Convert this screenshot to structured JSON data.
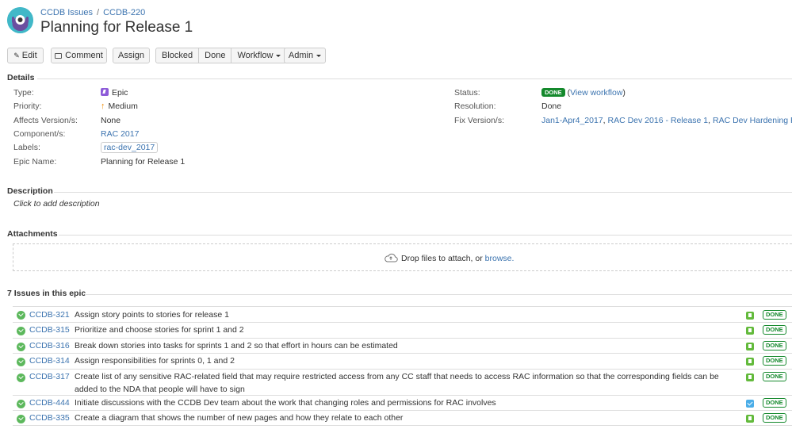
{
  "header": {
    "breadcrumb": {
      "project": "CCDB Issues",
      "separator": "/",
      "issue_key": "CCDB-220"
    },
    "title": "Planning for Release 1"
  },
  "toolbar": {
    "edit": "Edit",
    "comment": "Comment",
    "assign": "Assign",
    "blocked": "Blocked",
    "done": "Done",
    "workflow": "Workflow",
    "admin": "Admin"
  },
  "details": {
    "heading": "Details",
    "left": [
      {
        "label": "Type:",
        "value": "Epic",
        "icon": "epic-icon"
      },
      {
        "label": "Priority:",
        "value": "Medium",
        "icon": "priority-up-arrow-icon"
      },
      {
        "label": "Affects Version/s:",
        "value": "None"
      },
      {
        "label": "Component/s:",
        "value": "RAC 2017"
      },
      {
        "label": "Labels:",
        "value": "rac-dev_2017"
      },
      {
        "label": "Epic Name:",
        "value": "Planning for Release 1"
      }
    ],
    "right": {
      "status_label": "Status:",
      "status_value": "DONE",
      "view_workflow": "View workflow",
      "resolution_label": "Resolution:",
      "resolution_value": "Done",
      "fix_label": "Fix Version/s:",
      "fix_versions": [
        "Jan1-Apr4_2017",
        "RAC Dev 2016 - Release 1",
        "RAC Dev Hardening Rele"
      ]
    }
  },
  "description": {
    "heading": "Description",
    "placeholder": "Click to add description"
  },
  "attachments": {
    "heading": "Attachments",
    "drop_text": "Drop files to attach, or",
    "browse": "browse."
  },
  "epic_issues": {
    "heading": "7 Issues in this epic",
    "rows": [
      {
        "key": "CCDB-321",
        "summary": "Assign story points to stories for release 1",
        "type": "story",
        "status": "DONE"
      },
      {
        "key": "CCDB-315",
        "summary": "Prioritize and choose stories for sprint 1 and 2",
        "type": "story",
        "status": "DONE"
      },
      {
        "key": "CCDB-316",
        "summary": "Break down stories into tasks for sprints 1 and 2 so that effort in hours can be estimated",
        "type": "story",
        "status": "DONE"
      },
      {
        "key": "CCDB-314",
        "summary": "Assign responsibilities for sprints 0, 1 and 2",
        "type": "story",
        "status": "DONE"
      },
      {
        "key": "CCDB-317",
        "summary": "Create list of any sensitive RAC-related field that may require restricted access from any CC staff that needs to access RAC information so that the corresponding fields can be added to the NDA that people will have to sign",
        "type": "story",
        "status": "DONE"
      },
      {
        "key": "CCDB-444",
        "summary": "Initiate discussions with the CCDB Dev team about the work that changing roles and permissions for RAC involves",
        "type": "task",
        "status": "DONE"
      },
      {
        "key": "CCDB-335",
        "summary": "Create a diagram that shows the number of new pages and how they relate to each other",
        "type": "story",
        "status": "DONE"
      }
    ]
  }
}
